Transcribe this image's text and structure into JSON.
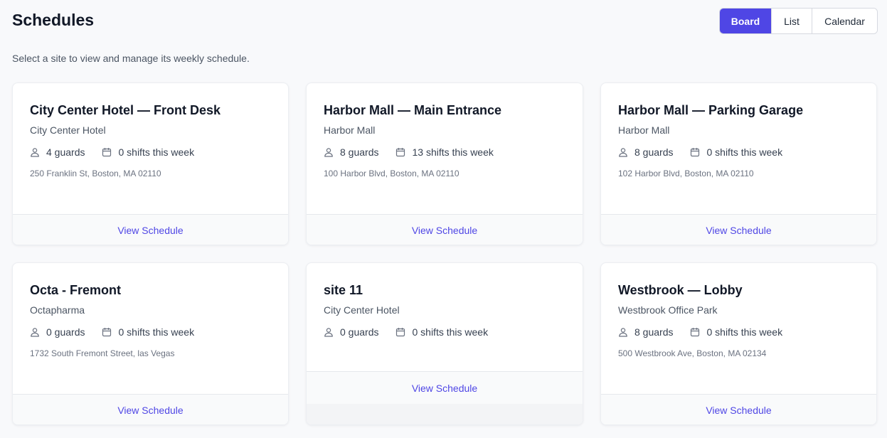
{
  "header": {
    "title": "Schedules",
    "subtitle": "Select a site to view and manage its weekly schedule."
  },
  "view_toggle": {
    "options": [
      "Board",
      "List",
      "Calendar"
    ],
    "selected": "Board"
  },
  "colors": {
    "accent": "#4f46e5",
    "background": "#f8f9fb",
    "card": "#ffffff"
  },
  "icons": {
    "guards": "user-icon",
    "shifts": "calendar-icon"
  },
  "sites": [
    {
      "name": "City Center Hotel — Front Desk",
      "org": "City Center Hotel",
      "guards": "4 guards",
      "shifts": "0 shifts this week",
      "address": "250 Franklin St, Boston, MA 02110",
      "action": "View Schedule"
    },
    {
      "name": "Harbor Mall — Main Entrance",
      "org": "Harbor Mall",
      "guards": "8 guards",
      "shifts": "13 shifts this week",
      "address": "100 Harbor Blvd, Boston, MA 02110",
      "action": "View Schedule"
    },
    {
      "name": "Harbor Mall — Parking Garage",
      "org": "Harbor Mall",
      "guards": "8 guards",
      "shifts": "0 shifts this week",
      "address": "102 Harbor Blvd, Boston, MA 02110",
      "action": "View Schedule"
    },
    {
      "name": "Octa - Fremont",
      "org": "Octapharma",
      "guards": "0 guards",
      "shifts": "0 shifts this week",
      "address": "1732 South Fremont Street, las Vegas",
      "action": "View Schedule"
    },
    {
      "name": "site 11",
      "org": "City Center Hotel",
      "guards": "0 guards",
      "shifts": "0 shifts this week",
      "address": "",
      "action": "View Schedule"
    },
    {
      "name": "Westbrook — Lobby",
      "org": "Westbrook Office Park",
      "guards": "8 guards",
      "shifts": "0 shifts this week",
      "address": "500 Westbrook Ave, Boston, MA 02134",
      "action": "View Schedule"
    }
  ]
}
